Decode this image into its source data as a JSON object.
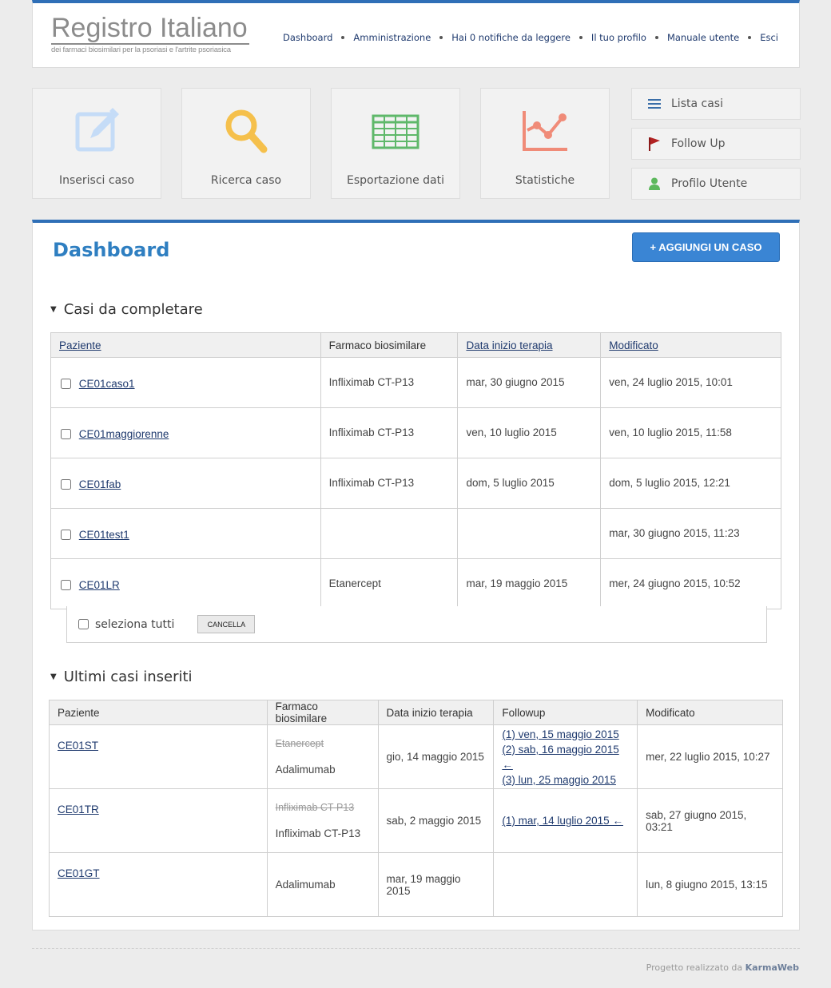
{
  "logo": {
    "title": "Registro Italiano",
    "subtitle": "dei farmaci biosimilari per la psoriasi e l'artrite psoriasica"
  },
  "topnav": [
    "Dashboard",
    "Amministrazione",
    "Hai 0 notifiche da leggere",
    "Il tuo profilo",
    "Manuale utente",
    "Esci"
  ],
  "tiles": [
    {
      "label": "Inserisci caso",
      "icon": "edit-icon",
      "color": "#c5dcf7"
    },
    {
      "label": "Ricerca caso",
      "icon": "search-icon",
      "color": "#f5c04c"
    },
    {
      "label": "Esportazione dati",
      "icon": "spreadsheet-icon",
      "color": "#5fb86a"
    },
    {
      "label": "Statistiche",
      "icon": "line-chart-icon",
      "color": "#f08b78"
    }
  ],
  "side_buttons": [
    {
      "label": "Lista casi",
      "icon": "list-icon"
    },
    {
      "label": "Follow Up",
      "icon": "flag-icon"
    },
    {
      "label": "Profilo Utente",
      "icon": "user-icon"
    }
  ],
  "main": {
    "title": "Dashboard",
    "add_button": "+ AGGIUNGI UN CASO",
    "section1": {
      "title": "Casi da completare",
      "headers": [
        "Paziente",
        "Farmaco biosimilare",
        "Data inizio terapia",
        "Modificato"
      ],
      "rows": [
        {
          "patient": "CE01caso1",
          "drug": "Infliximab CT-P13",
          "start": "mar, 30 giugno 2015",
          "modified": "ven, 24 luglio 2015, 10:01"
        },
        {
          "patient": "CE01maggiorenne",
          "drug": "Infliximab CT-P13",
          "start": "ven, 10 luglio 2015",
          "modified": "ven, 10 luglio 2015, 11:58"
        },
        {
          "patient": "CE01fab",
          "drug": "Infliximab CT-P13",
          "start": "dom, 5 luglio 2015",
          "modified": "dom, 5 luglio 2015, 12:21"
        },
        {
          "patient": "CE01test1",
          "drug": "",
          "start": "",
          "modified": "mar, 30 giugno 2015, 11:23"
        },
        {
          "patient": "CE01LR",
          "drug": "Etanercept",
          "start": "mar, 19 maggio 2015",
          "modified": "mer, 24 giugno 2015, 10:52"
        }
      ],
      "select_all": "seleziona tutti",
      "cancel_button": "CANCELLA"
    },
    "section2": {
      "title": "Ultimi casi inseriti",
      "headers": [
        "Paziente",
        "Farmaco biosimilare",
        "Data inizio terapia",
        "Followup",
        "Modificato"
      ],
      "rows": [
        {
          "patient": "CE01ST",
          "old_drug": "Etanercept",
          "drug": "Adalimumab",
          "start": "gio, 14 maggio 2015",
          "followups": [
            "(1) ven, 15 maggio 2015",
            "(2) sab, 16 maggio 2015 ←",
            "(3) lun, 25 maggio 2015"
          ],
          "modified": "mer, 22 luglio 2015, 10:27"
        },
        {
          "patient": "CE01TR",
          "old_drug": "Infliximab CT-P13",
          "drug": "Infliximab CT-P13",
          "start": "sab, 2 maggio 2015",
          "followups": [
            "(1) mar, 14 luglio 2015 ←"
          ],
          "modified": "sab, 27 giugno 2015, 03:21"
        },
        {
          "patient": "CE01GT",
          "old_drug": "",
          "drug": "Adalimumab",
          "start": "mar, 19 maggio 2015",
          "followups": [],
          "modified": "lun, 8 giugno 2015, 13:15"
        }
      ]
    }
  },
  "footer": {
    "text": "Progetto realizzato da",
    "brand": "KarmaWeb"
  }
}
